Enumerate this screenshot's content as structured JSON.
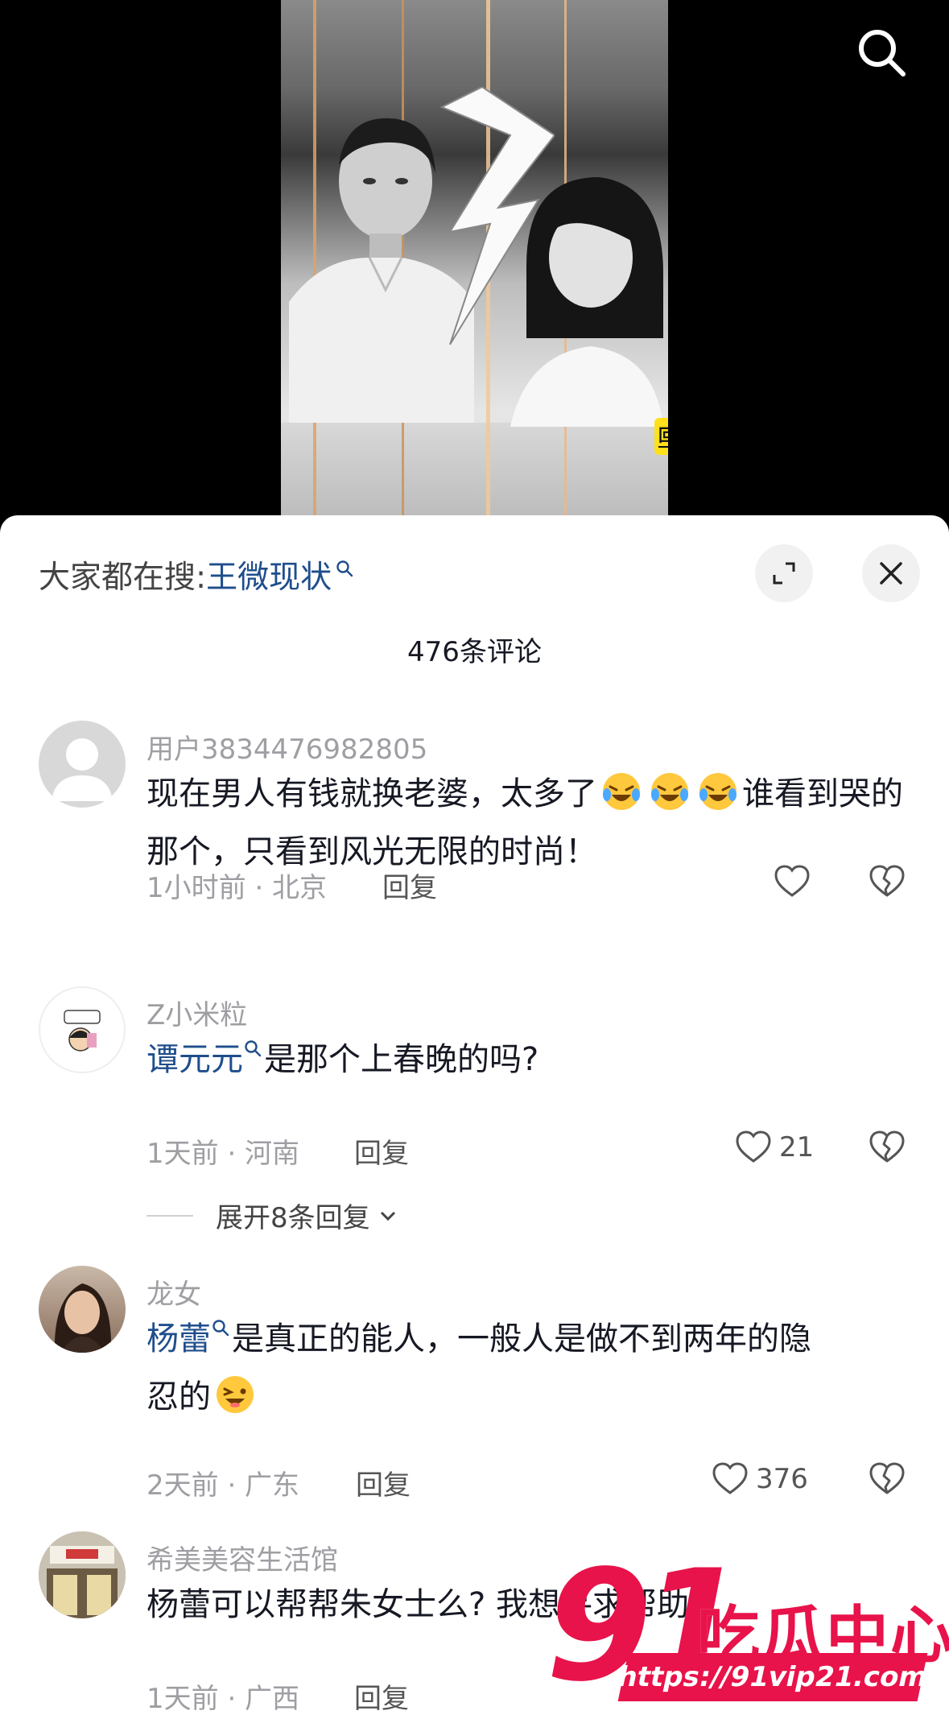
{
  "video": {
    "caption": "回家逼老婆杨蕾签字离婚"
  },
  "panel": {
    "trend_prefix": "大家都在搜:",
    "trend_keyword": "王微现状",
    "comment_count": "476条评论"
  },
  "comments": [
    {
      "user": "用户3834476982805",
      "text_before_emoji": "现在男人有钱就换老婆，太多了",
      "emoji_count": 3,
      "text_after_emoji": "谁看到哭的那个，只看到风光无限的时尚！",
      "time_location": "1小时前 · 北京",
      "reply_label": "回复",
      "likes": ""
    },
    {
      "user": "Z小米粒",
      "keyword": "谭元元",
      "text": "是那个上春晚的吗?",
      "time_location": "1天前 · 河南",
      "reply_label": "回复",
      "likes": "21",
      "expand_replies": "展开8条回复"
    },
    {
      "user": "龙女",
      "keyword": "杨蕾",
      "text_line1": "是真正的能人，一般人是做不到两年的隐",
      "text_line2": "忍的",
      "time_location": "2天前 · 广东",
      "reply_label": "回复",
      "likes": "376"
    },
    {
      "user": "希美美容生活馆",
      "text": "杨蕾可以帮帮朱女士么? 我想寻求帮助",
      "time_location": "1天前 · 广西",
      "reply_label": "回复"
    }
  ],
  "watermark": {
    "number": "91",
    "name": "吃瓜中心",
    "url": "https://91vip21.com"
  },
  "colors": {
    "link_blue": "#1f4e8c",
    "meta_gray": "#9e9ea3",
    "caption_yellow": "#ffe01a",
    "watermark_red": "#e8134a"
  },
  "icons": [
    "search-icon",
    "expand-icon",
    "close-icon",
    "heart-icon",
    "dislike-heart-icon",
    "chevron-down-icon",
    "laugh-cry-emoji",
    "grin-emoji"
  ]
}
